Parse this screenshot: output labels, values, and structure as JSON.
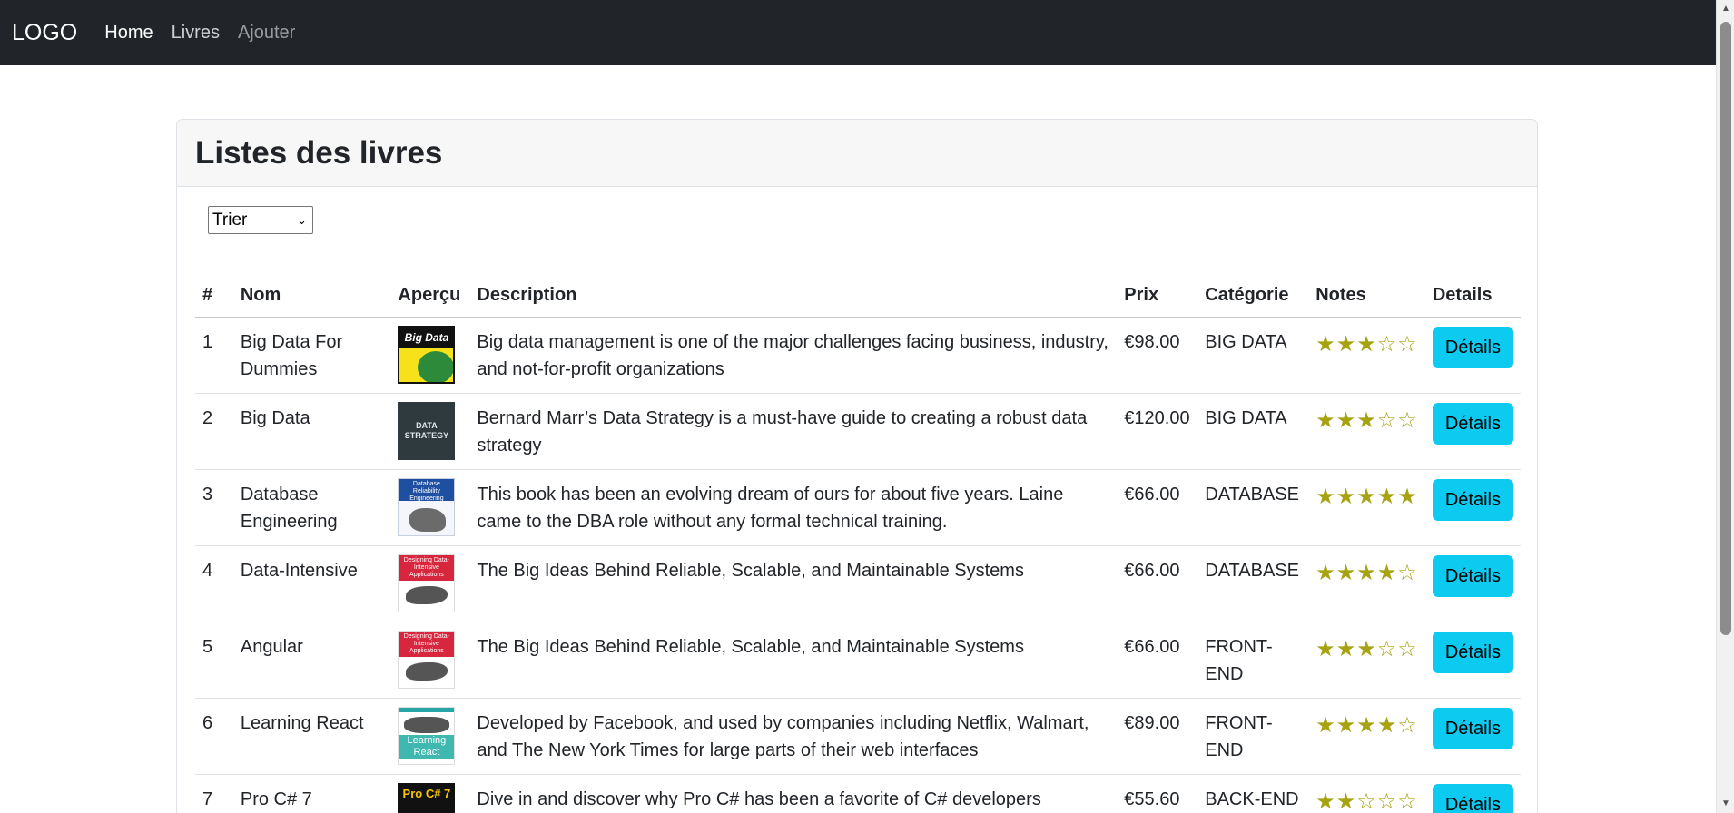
{
  "navbar": {
    "brand": "LOGO",
    "links": [
      {
        "label": "Home",
        "state": "active"
      },
      {
        "label": "Livres",
        "state": "normal"
      },
      {
        "label": "Ajouter",
        "state": "muted"
      }
    ]
  },
  "card": {
    "title": "Listes des livres",
    "sort_select": {
      "selected": "Trier"
    }
  },
  "table": {
    "headers": [
      "#",
      "Nom",
      "Aperçu",
      "Description",
      "Prix",
      "Catégorie",
      "Notes",
      "Details"
    ],
    "rows": [
      {
        "num": "1",
        "nom": "Big Data For Dummies",
        "cover": "Big Data",
        "description": "Big data management is one of the major challenges facing business, industry, and not-for-profit organizations",
        "prix": "€98.00",
        "categorie": "BIG DATA",
        "rating": 3,
        "button": "Détails"
      },
      {
        "num": "2",
        "nom": "Big Data",
        "cover": "DATA STRATEGY",
        "description": "Bernard Marr’s Data Strategy is a must-have guide to creating a robust data strategy",
        "prix": "€120.00",
        "categorie": "BIG DATA",
        "rating": 3,
        "button": "Détails"
      },
      {
        "num": "3",
        "nom": "Database Engineering",
        "cover": "Database Reliability Engineering",
        "description": "This book has been an evolving dream of ours for about five years. Laine came to the DBA role without any formal technical training.",
        "prix": "€66.00",
        "categorie": "DATABASE",
        "rating": 5,
        "button": "Détails"
      },
      {
        "num": "4",
        "nom": "Data-Intensive",
        "cover": "Designing Data-Intensive Applications",
        "description": "The Big Ideas Behind Reliable, Scalable, and Maintainable Systems",
        "prix": "€66.00",
        "categorie": "DATABASE",
        "rating": 4,
        "button": "Détails"
      },
      {
        "num": "5",
        "nom": "Angular",
        "cover": "Designing Data-Intensive Applications",
        "description": "The Big Ideas Behind Reliable, Scalable, and Maintainable Systems",
        "prix": "€66.00",
        "categorie": "FRONT-END",
        "rating": 3,
        "button": "Détails"
      },
      {
        "num": "6",
        "nom": "Learning React",
        "cover": "Learning React",
        "description": "Developed by Facebook, and used by companies including Netflix, Walmart, and The New York Times for large parts of their web interfaces",
        "prix": "€89.00",
        "categorie": "FRONT-END",
        "rating": 4,
        "button": "Détails"
      },
      {
        "num": "7",
        "nom": "Pro C# 7",
        "cover": "Pro C# 7",
        "description": "Dive in and discover why Pro C# has been a favorite of C# developers",
        "prix": "€55.60",
        "categorie": "BACK-END",
        "rating": 2,
        "button": "Détails"
      }
    ]
  },
  "colors": {
    "navbar_bg": "#212529",
    "button_bg": "#0dcaf0",
    "star_color": "#a7a20f"
  }
}
